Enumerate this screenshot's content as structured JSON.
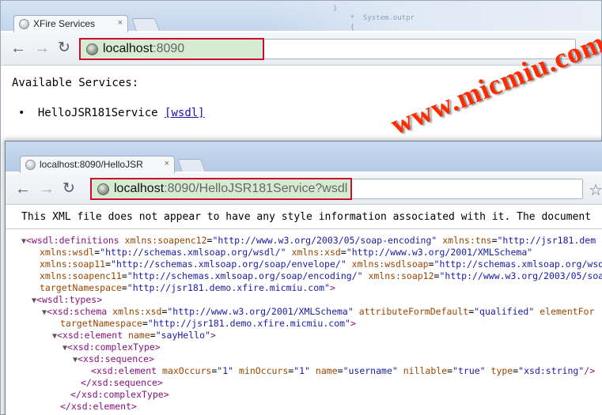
{
  "background_code": "}\n    *  System.outpr\n    {",
  "window1": {
    "tab_title": "XFire Services",
    "tab_close": "×",
    "url_host": "localhost",
    "url_rest": ":8090",
    "page": {
      "heading": "Available Services:",
      "service_name": "HelloJSR181Service",
      "wsdl_link": "[wsdl]"
    }
  },
  "window2": {
    "tab_title": "localhost:8090/HelloJSR",
    "tab_close": "×",
    "url_host": "localhost",
    "url_rest": ":8090/HelloJSR181Service?wsdl",
    "notice": "This XML file does not appear to have any style information associated with it. The document"
  },
  "navigation": {
    "back_icon": "←",
    "forward_icon": "→",
    "reload_icon": "↻",
    "bookmark_icon": "☆"
  },
  "watermark": "www.micmiu.com",
  "colors": {
    "highlight_border": "#c8102e",
    "highlight_fill": "#d6ecd2",
    "watermark": "#ff2a00",
    "xml_tag": "#881280",
    "xml_attr": "#994500",
    "xml_value": "#1a1aa6"
  },
  "xml_lines": [
    {
      "indent": 0,
      "toggle": "▼",
      "segments": [
        [
          "tag",
          "<wsdl:definitions "
        ],
        [
          "attr",
          "xmlns:soapenc12"
        ],
        [
          "txt",
          "="
        ],
        [
          "val",
          "\"http://www.w3.org/2003/05/soap-encoding\" "
        ],
        [
          "attr",
          "xmlns:tns"
        ],
        [
          "txt",
          "="
        ],
        [
          "val",
          "\"http://jsr181.dem"
        ]
      ]
    },
    {
      "indent": 1,
      "toggle": "",
      "segments": [
        [
          "attr",
          "xmlns:wsdl"
        ],
        [
          "txt",
          "="
        ],
        [
          "val",
          "\"http://schemas.xmlsoap.org/wsdl/\" "
        ],
        [
          "attr",
          "xmlns:xsd"
        ],
        [
          "txt",
          "="
        ],
        [
          "val",
          "\"http://www.w3.org/2001/XMLSchema\""
        ]
      ]
    },
    {
      "indent": 1,
      "toggle": "",
      "segments": [
        [
          "attr",
          "xmlns:soap11"
        ],
        [
          "txt",
          "="
        ],
        [
          "val",
          "\"http://schemas.xmlsoap.org/soap/envelope/\" "
        ],
        [
          "attr",
          "xmlns:wsdlsoap"
        ],
        [
          "txt",
          "="
        ],
        [
          "val",
          "\"http://schemas.xmlsoap.org/wsdl"
        ]
      ]
    },
    {
      "indent": 1,
      "toggle": "",
      "segments": [
        [
          "attr",
          "xmlns:soapenc11"
        ],
        [
          "txt",
          "="
        ],
        [
          "val",
          "\"http://schemas.xmlsoap.org/soap/encoding/\" "
        ],
        [
          "attr",
          "xmlns:soap12"
        ],
        [
          "txt",
          "="
        ],
        [
          "val",
          "\"http://www.w3.org/2003/05/soap"
        ]
      ]
    },
    {
      "indent": 1,
      "toggle": "",
      "segments": [
        [
          "attr",
          "targetNamespace"
        ],
        [
          "txt",
          "="
        ],
        [
          "val",
          "\"http://jsr181.demo.xfire.micmiu.com\""
        ],
        [
          "tag",
          ">"
        ]
      ]
    },
    {
      "indent": 1,
      "toggle": "▼",
      "segments": [
        [
          "tag",
          "<wsdl:types>"
        ]
      ]
    },
    {
      "indent": 2,
      "toggle": "▼",
      "segments": [
        [
          "tag",
          "<xsd:schema "
        ],
        [
          "attr",
          "xmlns:xsd"
        ],
        [
          "txt",
          "="
        ],
        [
          "val",
          "\"http://www.w3.org/2001/XMLSchema\" "
        ],
        [
          "attr",
          "attributeFormDefault"
        ],
        [
          "txt",
          "="
        ],
        [
          "val",
          "\"qualified\" "
        ],
        [
          "attr",
          "elementFor"
        ]
      ]
    },
    {
      "indent": 3,
      "toggle": "",
      "segments": [
        [
          "attr",
          "targetNamespace"
        ],
        [
          "txt",
          "="
        ],
        [
          "val",
          "\"http://jsr181.demo.xfire.micmiu.com\""
        ],
        [
          "tag",
          ">"
        ]
      ]
    },
    {
      "indent": 3,
      "toggle": "▼",
      "segments": [
        [
          "tag",
          "<xsd:element "
        ],
        [
          "attr",
          "name"
        ],
        [
          "txt",
          "="
        ],
        [
          "val",
          "\"sayHello\""
        ],
        [
          "tag",
          ">"
        ]
      ]
    },
    {
      "indent": 4,
      "toggle": "▼",
      "segments": [
        [
          "tag",
          "<xsd:complexType>"
        ]
      ]
    },
    {
      "indent": 5,
      "toggle": "▼",
      "segments": [
        [
          "tag",
          "<xsd:sequence>"
        ]
      ]
    },
    {
      "indent": 6,
      "toggle": "",
      "segments": [
        [
          "tag",
          "<xsd:element "
        ],
        [
          "attr",
          "maxOccurs"
        ],
        [
          "txt",
          "="
        ],
        [
          "val",
          "\"1\" "
        ],
        [
          "attr",
          "minOccurs"
        ],
        [
          "txt",
          "="
        ],
        [
          "val",
          "\"1\" "
        ],
        [
          "attr",
          "name"
        ],
        [
          "txt",
          "="
        ],
        [
          "val",
          "\"username\" "
        ],
        [
          "attr",
          "nillable"
        ],
        [
          "txt",
          "="
        ],
        [
          "val",
          "\"true\" "
        ],
        [
          "attr",
          "type"
        ],
        [
          "txt",
          "="
        ],
        [
          "val",
          "\"xsd:string\""
        ],
        [
          "tag",
          "/>"
        ]
      ]
    },
    {
      "indent": 5,
      "toggle": "",
      "segments": [
        [
          "tag",
          "</xsd:sequence>"
        ]
      ]
    },
    {
      "indent": 4,
      "toggle": "",
      "segments": [
        [
          "tag",
          "</xsd:complexType>"
        ]
      ]
    },
    {
      "indent": 3,
      "toggle": "",
      "segments": [
        [
          "tag",
          "</xsd:element>"
        ]
      ]
    }
  ]
}
